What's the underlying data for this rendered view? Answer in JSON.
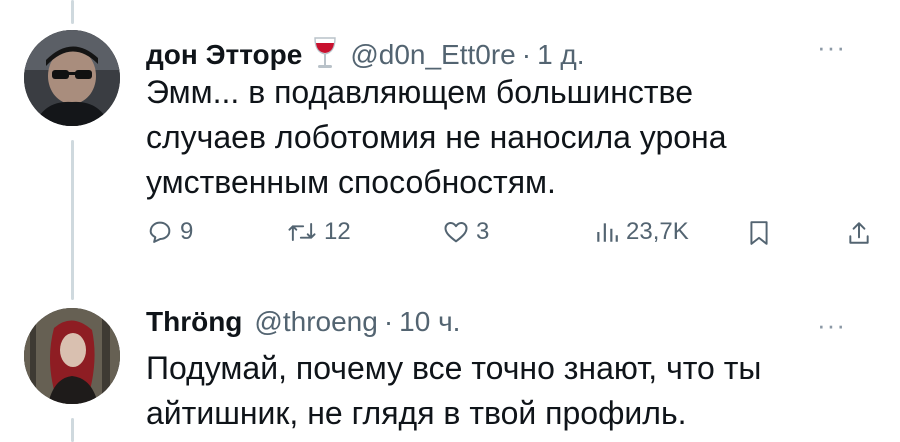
{
  "tweets": [
    {
      "display_name": "дон Этторе",
      "name_emoji": "wine-glass",
      "handle": "@d0n_Ett0re",
      "separator": "·",
      "time": "1 д.",
      "more": "···",
      "lines": [
        "Эмм... в подавляющем большинстве",
        "случаев лоботомия не наносила урона",
        "умственным способностям."
      ],
      "actions": {
        "replies": "9",
        "retweets": "12",
        "likes": "3",
        "views": "23,7K"
      }
    },
    {
      "display_name": "Thröng",
      "handle": "@throeng",
      "separator": "·",
      "time": "10 ч.",
      "more": "···",
      "lines": [
        "Подумай, почему все точно знают, что ты",
        "айтишник, не глядя в твой профиль."
      ]
    }
  ],
  "colors": {
    "text": "#0f1419",
    "secondary": "#536471",
    "thread_line": "#cfd9de",
    "wine": "#c8102e"
  }
}
